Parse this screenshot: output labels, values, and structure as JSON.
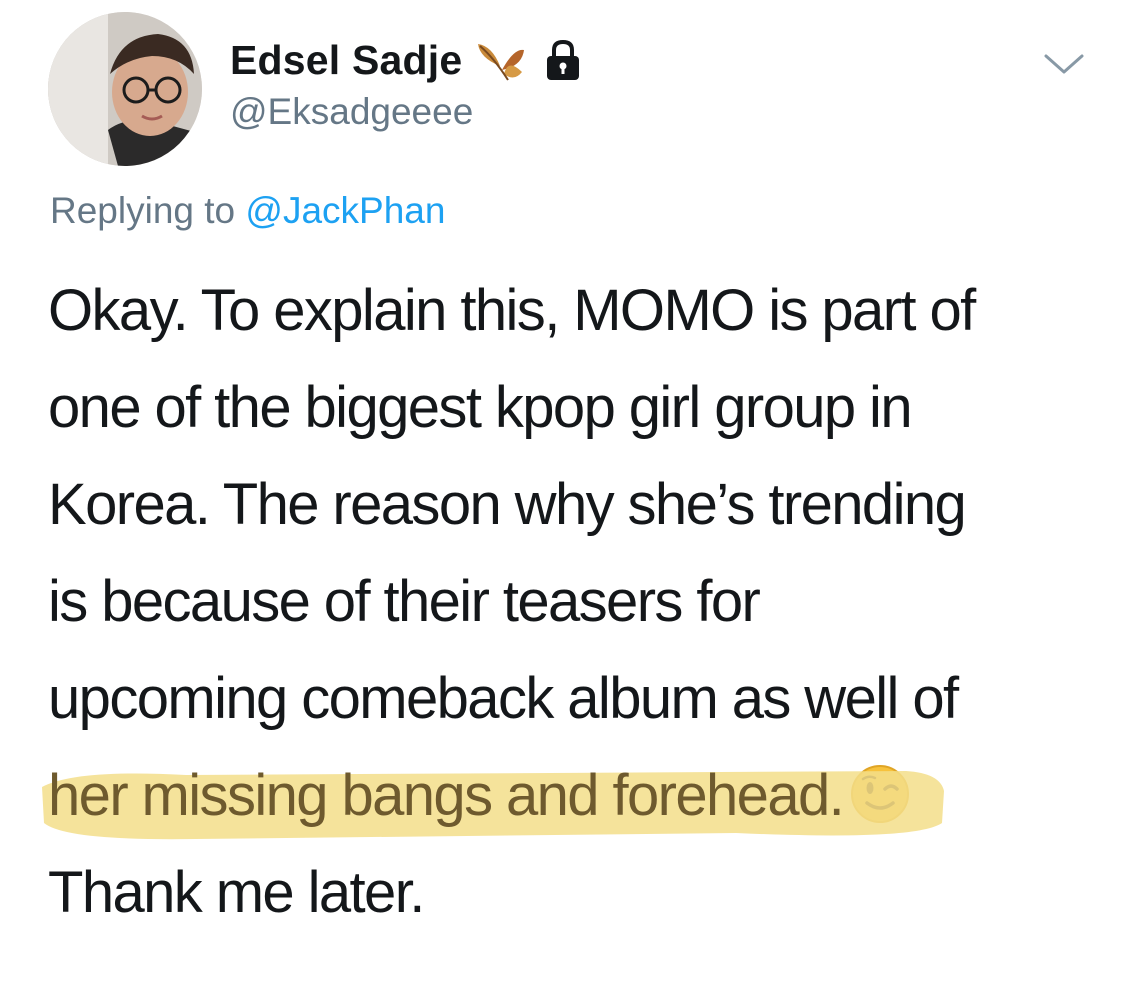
{
  "user": {
    "display_name": "Edsel Sadje",
    "handle": "@Eksadgeeee",
    "name_icons": [
      "autumn-leaves-icon",
      "lock-icon"
    ]
  },
  "reply": {
    "prefix": "Replying to ",
    "mention": "@JackPhan"
  },
  "tweet": {
    "lines": [
      "Okay. To explain this, MOMO is part of",
      "one of the biggest kpop girl group in",
      "Korea. The reason why she’s trending",
      "is because of their teasers for",
      "upcoming comeback album as well of"
    ],
    "highlighted_text": "her missing bangs and forehead.",
    "emoji": "winking-face-icon",
    "closing_line": "Thank me later."
  },
  "colors": {
    "text": "#14171a",
    "secondary": "#657786",
    "link": "#1da1f2",
    "highlight": "#f3de8a"
  }
}
